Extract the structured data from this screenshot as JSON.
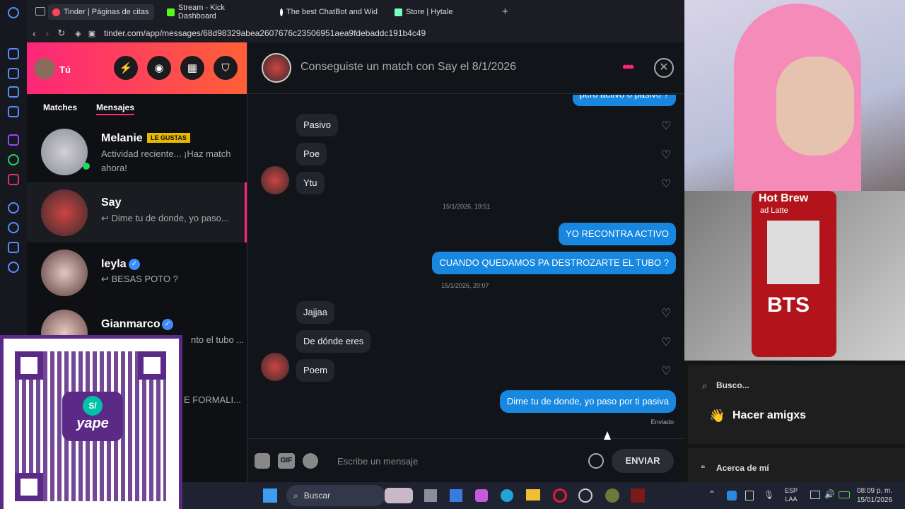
{
  "browser": {
    "tabs": [
      {
        "label": "Tinder | Páginas de citas",
        "color": "#ff4458"
      },
      {
        "label": "Stream - Kick Dashboard",
        "color": "#53fc18"
      },
      {
        "label": "The best ChatBot and Wid",
        "color": "#ffffff"
      },
      {
        "label": "Store | Hytale",
        "color": "#7fb"
      }
    ],
    "new_tab": "+",
    "url": "tinder.com/app/messages/68d98329abea2607676c23506951aea9fdebaddc191b4c49"
  },
  "sidebar": {
    "user_label": "Tú",
    "tabs": [
      "Matches",
      "Mensajes"
    ],
    "conversations": [
      {
        "name": "Melanie",
        "badge": "LE GUSTAS",
        "preview": "Actividad reciente... ¡Haz match ahora!"
      },
      {
        "name": "Say",
        "preview": "↩ Dime tu de donde, yo paso..."
      },
      {
        "name": "leyla",
        "preview": "↩ BESAS POTO ?"
      },
      {
        "name": "Gianmarco",
        "preview": "nto el tubo ..."
      }
    ],
    "partial_text": "E FORMALI..."
  },
  "chat": {
    "header": "Conseguiste un match con Say el 8/1/2026",
    "messages": [
      {
        "dir": "out",
        "text": "pero activo o pasivo ?"
      },
      {
        "dir": "in",
        "text": "Pasivo"
      },
      {
        "dir": "in",
        "text": "Poe"
      },
      {
        "dir": "in",
        "text": "Ytu"
      },
      {
        "dir": "ts",
        "text": "15/1/2026, 19:51"
      },
      {
        "dir": "out",
        "text": "YO RECONTRA ACTIVO"
      },
      {
        "dir": "out",
        "text": "CUANDO QUEDAMOS PA DESTROZARTE EL TUBO ?"
      },
      {
        "dir": "ts",
        "text": "15/1/2026, 20:07"
      },
      {
        "dir": "in",
        "text": "Jajjaa"
      },
      {
        "dir": "in",
        "text": "De dónde eres"
      },
      {
        "dir": "in",
        "text": "Poem"
      },
      {
        "dir": "out",
        "text": "Dime tu de donde, yo paso por ti pasiva"
      }
    ],
    "sent_status": "Enviado",
    "input_placeholder": "Escribe un mensaje",
    "send_label": "ENVIAR",
    "gif_label": "GIF"
  },
  "stream_overlay": {
    "search_label": "Busco...",
    "goal_label": "Hacer amigxs",
    "about_label": "Acerca de mí",
    "can_text_lines": [
      "Hot Brew",
      "ad Latte",
      "BTS"
    ]
  },
  "qr": {
    "brand": "yape",
    "badge": "S/"
  },
  "taskbar": {
    "search": "Buscar",
    "lang_top": "ESP",
    "lang_bottom": "LAA",
    "time": "08:09 p. m.",
    "date": "15/01/2026"
  }
}
